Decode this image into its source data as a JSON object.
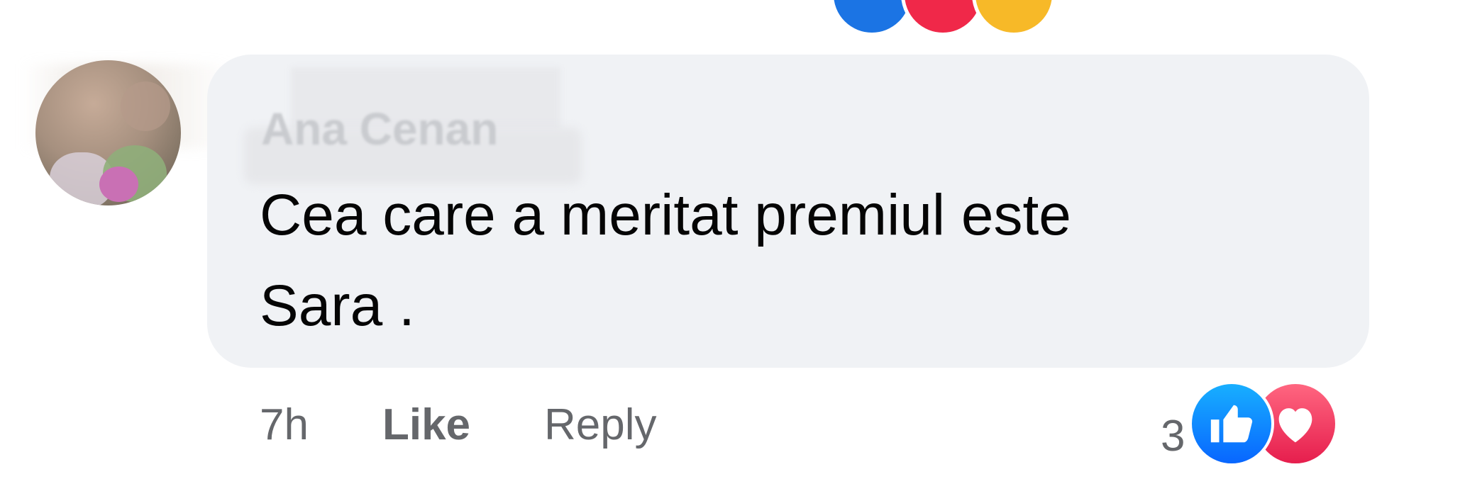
{
  "comment": {
    "author": "Ana Cenan",
    "text": "Cea care a meritat premiul este\nSara .",
    "time": "7h",
    "like_label": "Like",
    "reply_label": "Reply",
    "reaction_count": "3",
    "reactions": [
      "like-icon",
      "love-icon"
    ]
  },
  "colors": {
    "bubble": "#f0f2f5",
    "like_blue": "#0866ff",
    "love_red": "#e61e4d",
    "secondary_text": "#65676b"
  }
}
